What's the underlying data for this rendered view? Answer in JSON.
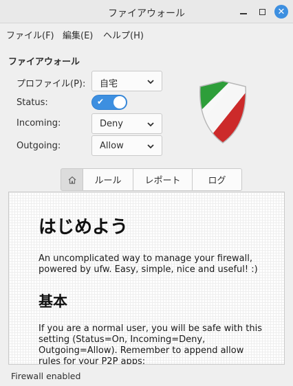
{
  "window": {
    "title": "ファイアウォール",
    "controls": {
      "minimize_icon": "minimize-icon",
      "maximize_icon": "maximize-icon",
      "close_icon": "close-icon"
    }
  },
  "menubar": {
    "items": [
      {
        "label": "ファイル(F)"
      },
      {
        "label": "編集(E)"
      },
      {
        "label": "ヘルプ(H)"
      }
    ]
  },
  "firewall": {
    "section_title": "ファイアウォール",
    "profile": {
      "label": "プロファイル(P):",
      "value": "自宅"
    },
    "status": {
      "label": "Status:",
      "enabled": true,
      "check_glyph": "✔"
    },
    "incoming": {
      "label": "Incoming:",
      "value": "Deny"
    },
    "outgoing": {
      "label": "Outgoing:",
      "value": "Allow"
    },
    "shield_colors": [
      "#2e9e3a",
      "#ffffff",
      "#cc2a2a"
    ]
  },
  "tabs": [
    {
      "label": "",
      "icon": "home-icon",
      "active": true
    },
    {
      "label": "ルール",
      "active": false
    },
    {
      "label": "レポート",
      "active": false
    },
    {
      "label": "ログ",
      "active": false
    }
  ],
  "content": {
    "heading": "はじめよう",
    "intro_line1": "An uncomplicated way to manage your firewall,",
    "intro_line2": "powered by ufw. Easy, simple, nice and useful! :)",
    "subheading": "基本",
    "basic_line1": "If you are a normal user, you will be safe with this",
    "basic_line2": "setting (Status=On, Incoming=Deny,",
    "basic_line3": "Outgoing=Allow). Remember to append allow",
    "basic_line4": "rules for your P2P apps:"
  },
  "statusbar": {
    "text": "Firewall enabled"
  },
  "colors": {
    "accent": "#3d8fe0",
    "window_bg": "#efefef"
  }
}
